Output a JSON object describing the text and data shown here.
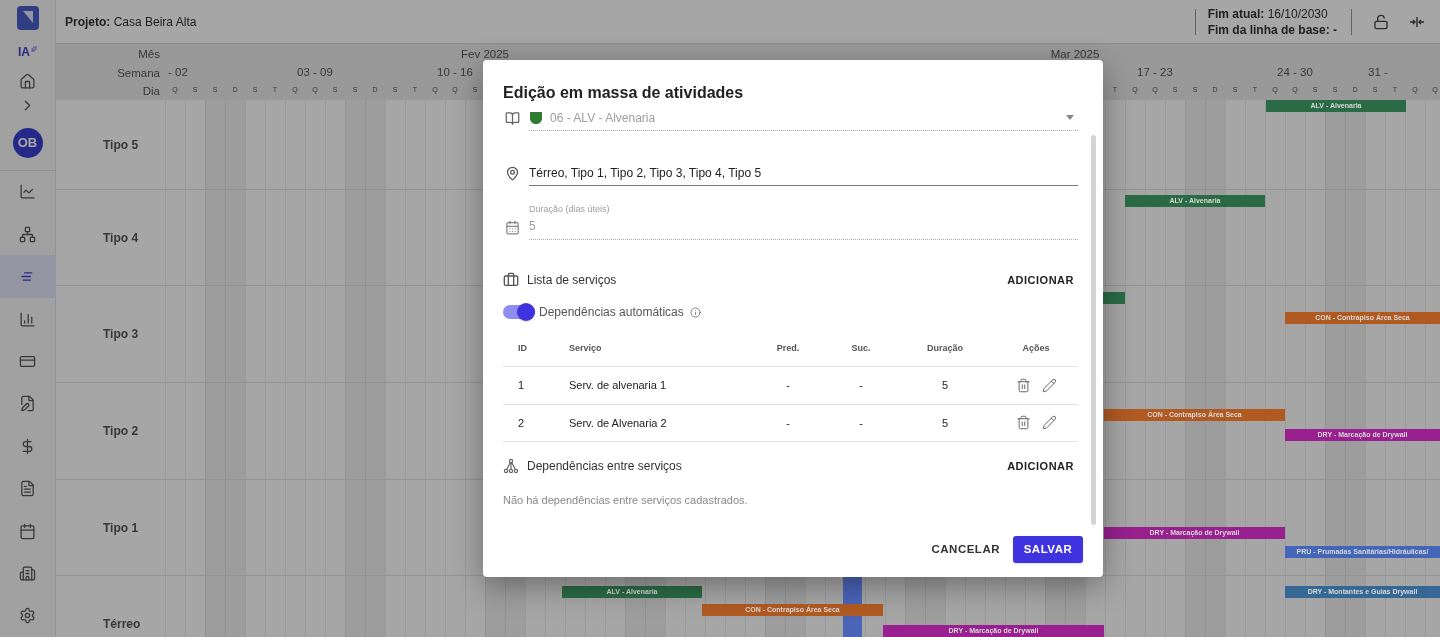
{
  "sidebar": {
    "ai_label": "IA",
    "nav_top": [
      {
        "kind": "home"
      },
      {
        "kind": "expand"
      }
    ],
    "avatar": "OB",
    "nav": [
      {
        "kind": "chart",
        "selected": false
      },
      {
        "kind": "hierarchy",
        "selected": false
      },
      {
        "kind": "gantt",
        "selected": true
      },
      {
        "kind": "bars",
        "selected": false
      },
      {
        "kind": "card",
        "selected": false
      },
      {
        "kind": "edit",
        "selected": false
      },
      {
        "kind": "money",
        "selected": false
      },
      {
        "kind": "list",
        "selected": false
      },
      {
        "kind": "calendar",
        "selected": false
      },
      {
        "kind": "building",
        "selected": false
      },
      {
        "kind": "settings",
        "selected": false
      }
    ]
  },
  "top_bar": {
    "project": "**Projeto:** Casa Beira Alta",
    "current_end": "**Fim atual:** 16/10/2030",
    "baseline_end": "**Fim da linha de base: -**"
  },
  "gantt": {
    "header_labels": [
      "Mês",
      "Semana",
      "Dia"
    ],
    "months": [
      {
        "label": "Fev 2025"
      },
      {
        "label": "Mar 2025"
      }
    ],
    "weeks": [
      {
        "label": "- 02"
      },
      {
        "label": "03 - 09"
      },
      {
        "label": "10 - 16"
      },
      {
        "label": "17 - 23"
      },
      {
        "label": "24 - 30"
      },
      {
        "label": "31 -"
      }
    ],
    "days_before_dialog": [
      "Q",
      "S",
      "S",
      "D",
      "S",
      "T",
      "Q",
      "Q",
      "S",
      "S",
      "D",
      "S",
      "T",
      "Q",
      "Q",
      "S"
    ],
    "days_after_dialog": [
      "T",
      "Q",
      "Q",
      "S",
      "S",
      "D",
      "S",
      "T",
      "Q",
      "Q",
      "S",
      "S",
      "D",
      "S",
      "T",
      "Q",
      "Q"
    ],
    "rows": [
      {
        "label": "Tipo 5",
        "bars": [
          {
            "label": "ALV - Alvenaria",
            "color": "#2a6b45"
          }
        ]
      },
      {
        "label": "Tipo 4",
        "bars": [
          {
            "label": "ALV - Alvenaria",
            "color": "#2a6b45"
          }
        ]
      },
      {
        "label": "Tipo 3",
        "bars": [
          {
            "color": "#2a6b45"
          },
          {
            "label": "CON - Contrapiso Área Seca",
            "color": "#b05a22"
          }
        ]
      },
      {
        "label": "Tipo 2",
        "bars": [
          {
            "label": "CON - Contrapiso Área Seca",
            "color": "#b05a22"
          },
          {
            "label": "DRY - Marcação de Drywall",
            "color": "#98208f"
          }
        ]
      },
      {
        "label": "Tipo 1",
        "bars": [
          {
            "label": "DRY - Marcação de Drywall",
            "color": "#98208f"
          },
          {
            "label": "PRU - Prumadas Sanitárias/Hidráulicas/",
            "color": "#4466b8"
          }
        ]
      },
      {
        "label": "Térreo",
        "bars": [
          {
            "label": "ALV - Alvenaria",
            "color": "#2a6b45"
          },
          {
            "label": "DRY - Montantes e Guias Drywall",
            "color": "#366894"
          },
          {
            "label": "CON - Contrapiso Área Seca",
            "color": "#b05a22"
          },
          {
            "label": "DRY - Marcação de Drywall",
            "color": "#98208f"
          }
        ]
      }
    ]
  },
  "dialog": {
    "title": "Edição em massa de atividades",
    "discipline": {
      "value": "06 - ALV - Alvenaria",
      "disabled": true
    },
    "locations": {
      "value": "Térreo, Tipo 1, Tipo 2, Tipo 3, Tipo 4, Tipo 5"
    },
    "duration": {
      "label": "Duração (dias úteis)",
      "value": "5",
      "disabled": true
    },
    "services": {
      "title": "Lista de serviços",
      "add": "ADICIONAR",
      "auto_dependencies": {
        "label": "Dependências automáticas",
        "on": true
      },
      "columns": [
        "ID",
        "Serviço",
        "Pred.",
        "Suc.",
        "Duração",
        "Ações"
      ],
      "rows": [
        [
          "1",
          "Serv. de alvenaria 1",
          "-",
          "-",
          "5"
        ],
        [
          "2",
          "Serv. de Alvenaria 2",
          "-",
          "-",
          "5"
        ]
      ]
    },
    "dependencies": {
      "title": "Dependências entre serviços",
      "add": "ADICIONAR",
      "empty": "Não há dependências entre serviços cadastrados."
    },
    "buttons": {
      "cancel": "CANCELAR",
      "save": "SALVAR"
    }
  }
}
